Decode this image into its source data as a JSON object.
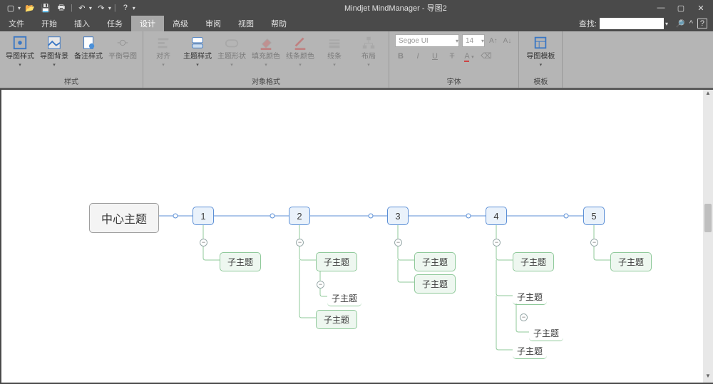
{
  "titlebar": {
    "title": "Mindjet MindManager - 导图2",
    "qat": [
      "new-icon",
      "open-icon",
      "save-icon",
      "print-icon",
      "undo-icon",
      "redo-icon",
      "help-icon"
    ]
  },
  "menu": {
    "tabs": [
      "文件",
      "开始",
      "插入",
      "任务",
      "设计",
      "高级",
      "审阅",
      "视图",
      "帮助"
    ],
    "active_index": 4,
    "find_label": "查找:",
    "find_value": ""
  },
  "ribbon": {
    "groups": [
      {
        "name": "样式",
        "buttons": [
          {
            "label": "导图样式",
            "disabled": false,
            "dd": true,
            "icon": "map-style"
          },
          {
            "label": "导图背景",
            "disabled": false,
            "dd": true,
            "icon": "map-bg"
          },
          {
            "label": "备注样式",
            "disabled": false,
            "dd": false,
            "icon": "note-style"
          },
          {
            "label": "平衡导图",
            "disabled": true,
            "dd": false,
            "icon": "balance"
          }
        ]
      },
      {
        "name": "对象格式",
        "buttons": [
          {
            "label": "对齐",
            "disabled": true,
            "dd": true,
            "icon": "align"
          },
          {
            "label": "主题样式",
            "disabled": false,
            "dd": true,
            "icon": "topic-style"
          },
          {
            "label": "主题形状",
            "disabled": true,
            "dd": true,
            "icon": "topic-shape"
          },
          {
            "label": "填充颜色",
            "disabled": true,
            "dd": true,
            "icon": "fill"
          },
          {
            "label": "线条颜色",
            "disabled": true,
            "dd": true,
            "icon": "line-color"
          },
          {
            "label": "线条",
            "disabled": true,
            "dd": true,
            "icon": "line"
          },
          {
            "label": "布局",
            "disabled": true,
            "dd": true,
            "icon": "layout"
          }
        ]
      }
    ],
    "font": {
      "group_name": "字体",
      "family": "Segoe UI",
      "size": "14",
      "buttons": [
        "B",
        "I",
        "U",
        "T",
        "A"
      ]
    },
    "template": {
      "group_name": "模板",
      "label": "导图模板"
    }
  },
  "mindmap": {
    "central": "中心主题",
    "mains": [
      "1",
      "2",
      "3",
      "4",
      "5"
    ],
    "subs": {
      "1": [
        "子主题"
      ],
      "2": [
        "子主题",
        "子主题",
        "子主题"
      ],
      "3": [
        "子主题",
        "子主题"
      ],
      "4": [
        "子主题",
        "子主题",
        "子主题",
        "子主题"
      ],
      "5": [
        "子主题"
      ]
    }
  }
}
